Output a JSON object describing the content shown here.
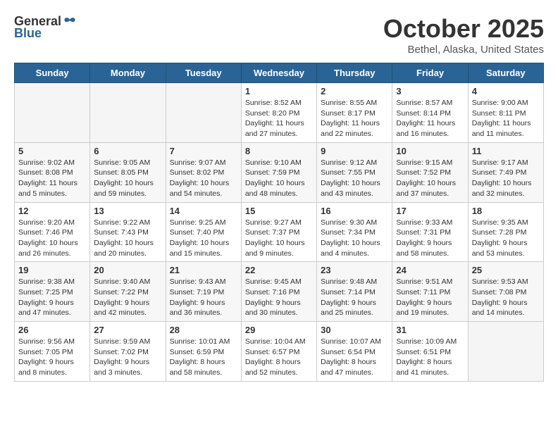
{
  "header": {
    "logo_general": "General",
    "logo_blue": "Blue",
    "month_title": "October 2025",
    "location": "Bethel, Alaska, United States"
  },
  "calendar": {
    "days_of_week": [
      "Sunday",
      "Monday",
      "Tuesday",
      "Wednesday",
      "Thursday",
      "Friday",
      "Saturday"
    ],
    "weeks": [
      [
        {
          "day": "",
          "info": ""
        },
        {
          "day": "",
          "info": ""
        },
        {
          "day": "",
          "info": ""
        },
        {
          "day": "1",
          "info": "Sunrise: 8:52 AM\nSunset: 8:20 PM\nDaylight: 11 hours and 27 minutes."
        },
        {
          "day": "2",
          "info": "Sunrise: 8:55 AM\nSunset: 8:17 PM\nDaylight: 11 hours and 22 minutes."
        },
        {
          "day": "3",
          "info": "Sunrise: 8:57 AM\nSunset: 8:14 PM\nDaylight: 11 hours and 16 minutes."
        },
        {
          "day": "4",
          "info": "Sunrise: 9:00 AM\nSunset: 8:11 PM\nDaylight: 11 hours and 11 minutes."
        }
      ],
      [
        {
          "day": "5",
          "info": "Sunrise: 9:02 AM\nSunset: 8:08 PM\nDaylight: 11 hours and 5 minutes."
        },
        {
          "day": "6",
          "info": "Sunrise: 9:05 AM\nSunset: 8:05 PM\nDaylight: 10 hours and 59 minutes."
        },
        {
          "day": "7",
          "info": "Sunrise: 9:07 AM\nSunset: 8:02 PM\nDaylight: 10 hours and 54 minutes."
        },
        {
          "day": "8",
          "info": "Sunrise: 9:10 AM\nSunset: 7:59 PM\nDaylight: 10 hours and 48 minutes."
        },
        {
          "day": "9",
          "info": "Sunrise: 9:12 AM\nSunset: 7:55 PM\nDaylight: 10 hours and 43 minutes."
        },
        {
          "day": "10",
          "info": "Sunrise: 9:15 AM\nSunset: 7:52 PM\nDaylight: 10 hours and 37 minutes."
        },
        {
          "day": "11",
          "info": "Sunrise: 9:17 AM\nSunset: 7:49 PM\nDaylight: 10 hours and 32 minutes."
        }
      ],
      [
        {
          "day": "12",
          "info": "Sunrise: 9:20 AM\nSunset: 7:46 PM\nDaylight: 10 hours and 26 minutes."
        },
        {
          "day": "13",
          "info": "Sunrise: 9:22 AM\nSunset: 7:43 PM\nDaylight: 10 hours and 20 minutes."
        },
        {
          "day": "14",
          "info": "Sunrise: 9:25 AM\nSunset: 7:40 PM\nDaylight: 10 hours and 15 minutes."
        },
        {
          "day": "15",
          "info": "Sunrise: 9:27 AM\nSunset: 7:37 PM\nDaylight: 10 hours and 9 minutes."
        },
        {
          "day": "16",
          "info": "Sunrise: 9:30 AM\nSunset: 7:34 PM\nDaylight: 10 hours and 4 minutes."
        },
        {
          "day": "17",
          "info": "Sunrise: 9:33 AM\nSunset: 7:31 PM\nDaylight: 9 hours and 58 minutes."
        },
        {
          "day": "18",
          "info": "Sunrise: 9:35 AM\nSunset: 7:28 PM\nDaylight: 9 hours and 53 minutes."
        }
      ],
      [
        {
          "day": "19",
          "info": "Sunrise: 9:38 AM\nSunset: 7:25 PM\nDaylight: 9 hours and 47 minutes."
        },
        {
          "day": "20",
          "info": "Sunrise: 9:40 AM\nSunset: 7:22 PM\nDaylight: 9 hours and 42 minutes."
        },
        {
          "day": "21",
          "info": "Sunrise: 9:43 AM\nSunset: 7:19 PM\nDaylight: 9 hours and 36 minutes."
        },
        {
          "day": "22",
          "info": "Sunrise: 9:45 AM\nSunset: 7:16 PM\nDaylight: 9 hours and 30 minutes."
        },
        {
          "day": "23",
          "info": "Sunrise: 9:48 AM\nSunset: 7:14 PM\nDaylight: 9 hours and 25 minutes."
        },
        {
          "day": "24",
          "info": "Sunrise: 9:51 AM\nSunset: 7:11 PM\nDaylight: 9 hours and 19 minutes."
        },
        {
          "day": "25",
          "info": "Sunrise: 9:53 AM\nSunset: 7:08 PM\nDaylight: 9 hours and 14 minutes."
        }
      ],
      [
        {
          "day": "26",
          "info": "Sunrise: 9:56 AM\nSunset: 7:05 PM\nDaylight: 9 hours and 8 minutes."
        },
        {
          "day": "27",
          "info": "Sunrise: 9:59 AM\nSunset: 7:02 PM\nDaylight: 9 hours and 3 minutes."
        },
        {
          "day": "28",
          "info": "Sunrise: 10:01 AM\nSunset: 6:59 PM\nDaylight: 8 hours and 58 minutes."
        },
        {
          "day": "29",
          "info": "Sunrise: 10:04 AM\nSunset: 6:57 PM\nDaylight: 8 hours and 52 minutes."
        },
        {
          "day": "30",
          "info": "Sunrise: 10:07 AM\nSunset: 6:54 PM\nDaylight: 8 hours and 47 minutes."
        },
        {
          "day": "31",
          "info": "Sunrise: 10:09 AM\nSunset: 6:51 PM\nDaylight: 8 hours and 41 minutes."
        },
        {
          "day": "",
          "info": ""
        }
      ]
    ]
  }
}
